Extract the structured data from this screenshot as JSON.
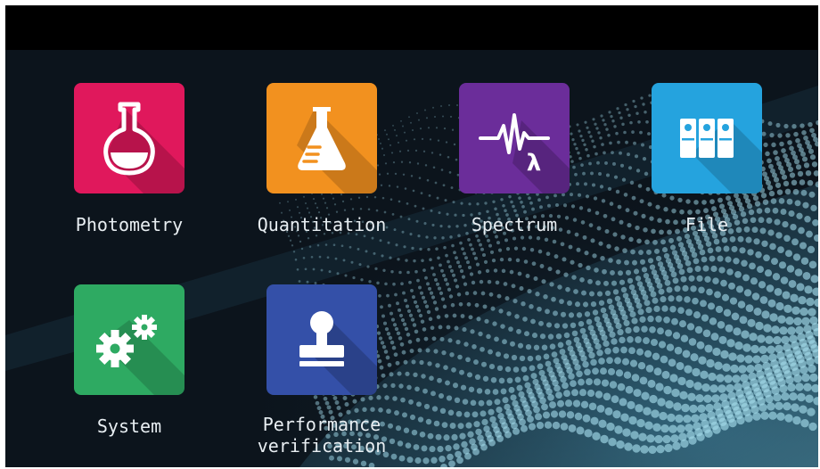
{
  "apps": [
    {
      "label": "Photometry",
      "icon": "flask-icon",
      "color": "#e0185c"
    },
    {
      "label": "Quantitation",
      "icon": "erlenmeyer-flask-icon",
      "color": "#f2911f"
    },
    {
      "label": "Spectrum",
      "icon": "spectrum-lambda-icon",
      "color": "#6b2d9a"
    },
    {
      "label": "File",
      "icon": "binders-icon",
      "color": "#25a3de"
    },
    {
      "label": "System",
      "icon": "gears-icon",
      "color": "#2eaa62"
    },
    {
      "label_line1": "Performance",
      "label_line2": "verification",
      "icon": "stamp-icon",
      "color": "#3450a8"
    }
  ]
}
